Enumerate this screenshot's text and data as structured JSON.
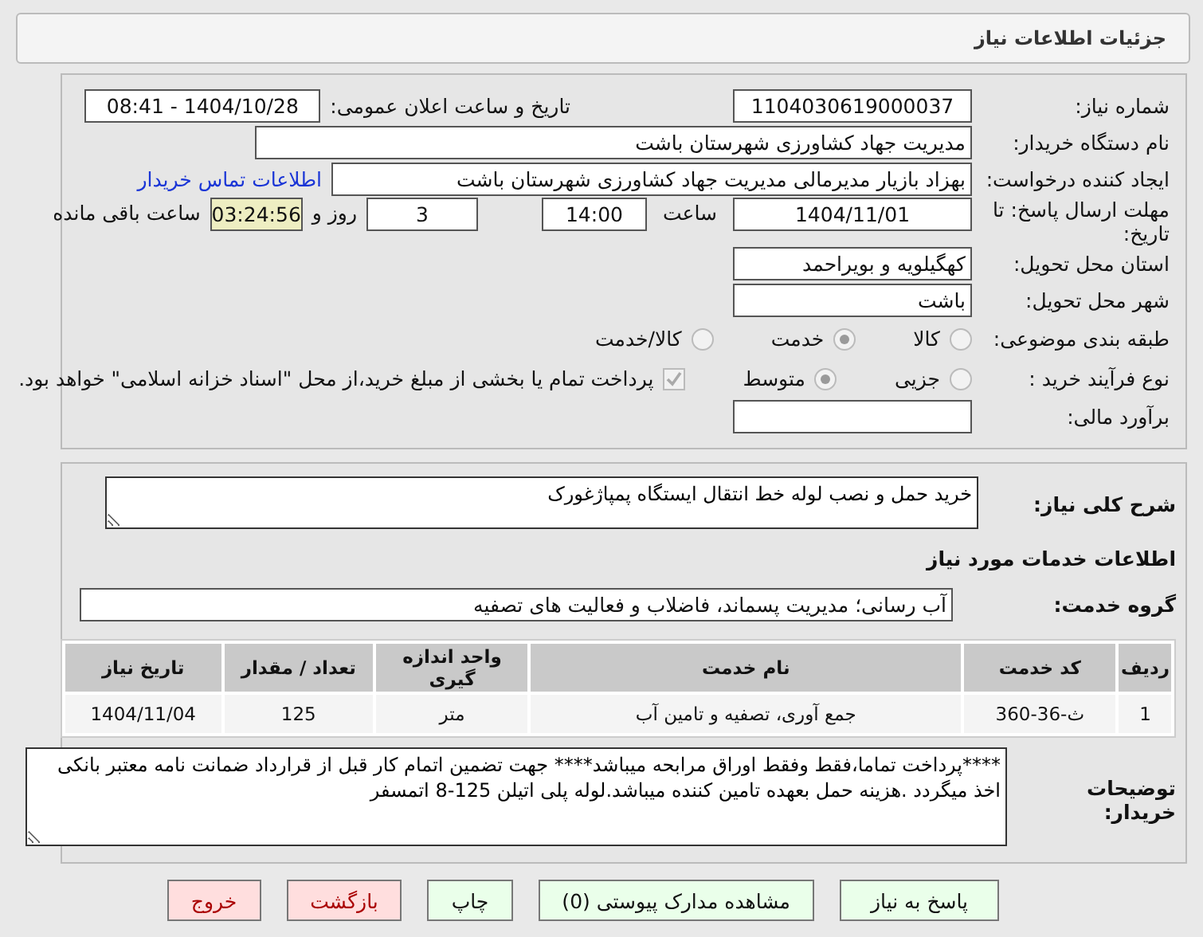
{
  "header": {
    "title": "جزئیات اطلاعات نیاز"
  },
  "need_number": {
    "label": "شماره نیاز:",
    "value": "1104030619000037"
  },
  "announce_date": {
    "label": "تاریخ و ساعت اعلان عمومی:",
    "value": "1404/10/28 - 08:41"
  },
  "buyer_org": {
    "label": "نام دستگاه خریدار:",
    "value": "مدیریت جهاد کشاورزی شهرستان باشت"
  },
  "requester": {
    "label": "ایجاد کننده درخواست:",
    "value": "بهزاد بازیار مدیرمالی مدیریت جهاد کشاورزی شهرستان باشت",
    "link": "اطلاعات تماس خریدار"
  },
  "deadline": {
    "label": "مهلت ارسال پاسخ: تا تاریخ:",
    "date": "1404/11/01",
    "time_label": "ساعت",
    "time": "14:00",
    "days": "3",
    "days_label": "روز و",
    "remaining": "03:24:56",
    "remaining_label": "ساعت باقی مانده"
  },
  "province": {
    "label": "استان محل تحویل:",
    "value": "کهگیلویه و بویراحمد"
  },
  "city": {
    "label": "شهر محل تحویل:",
    "value": "باشت"
  },
  "category": {
    "label": "طبقه بندی موضوعی:",
    "options": [
      {
        "label": "کالا",
        "selected": false
      },
      {
        "label": "خدمت",
        "selected": true
      },
      {
        "label": "کالا/خدمت",
        "selected": false
      }
    ]
  },
  "purchase_type": {
    "label": "نوع فرآیند خرید :",
    "options": [
      {
        "label": "جزیی",
        "selected": false
      },
      {
        "label": "متوسط",
        "selected": true
      }
    ],
    "payment_checkbox": {
      "checked": true,
      "text": "پرداخت تمام یا بخشی از مبلغ خرید،از محل \"اسناد خزانه اسلامی\" خواهد بود."
    }
  },
  "budget": {
    "label": "برآورد مالی:"
  },
  "description": {
    "label": "شرح کلی نیاز:",
    "value": "خرید حمل و نصب لوله خط انتقال ایستگاه پمپاژغورک"
  },
  "services_title": "اطلاعات خدمات مورد نیاز",
  "service_group": {
    "label": "گروه خدمت:",
    "value": "آب رسانی؛ مدیریت پسماند، فاضلاب و فعالیت های تصفیه"
  },
  "table": {
    "columns": [
      "ردیف",
      "کد خدمت",
      "نام خدمت",
      "واحد اندازه گیری",
      "تعداد / مقدار",
      "تاریخ نیاز"
    ],
    "rows": [
      [
        "1",
        "ث-36-360",
        "جمع آوری، تصفیه و تامین آب",
        "متر",
        "125",
        "1404/11/04"
      ]
    ]
  },
  "buyer_notes": {
    "label": "توضیحات خریدار:",
    "value": "****پرداخت تماما،فقط وفقط اوراق مرابحه میباشد**** جهت تضمین اتمام کار قبل از قرارداد ضمانت نامه معتبر بانکی اخذ میگردد .هزینه حمل بعهده تامین کننده میباشد.لوله پلی اتیلن 125-8 اتمسفر"
  },
  "buttons": [
    {
      "label": "پاسخ به نیاز",
      "kind": "primary"
    },
    {
      "label": "مشاهده مدارک پیوستی (0)",
      "kind": "primary"
    },
    {
      "label": "چاپ",
      "kind": "primary"
    },
    {
      "label": "بازگشت",
      "kind": "danger"
    },
    {
      "label": "خروج",
      "kind": "danger"
    }
  ]
}
